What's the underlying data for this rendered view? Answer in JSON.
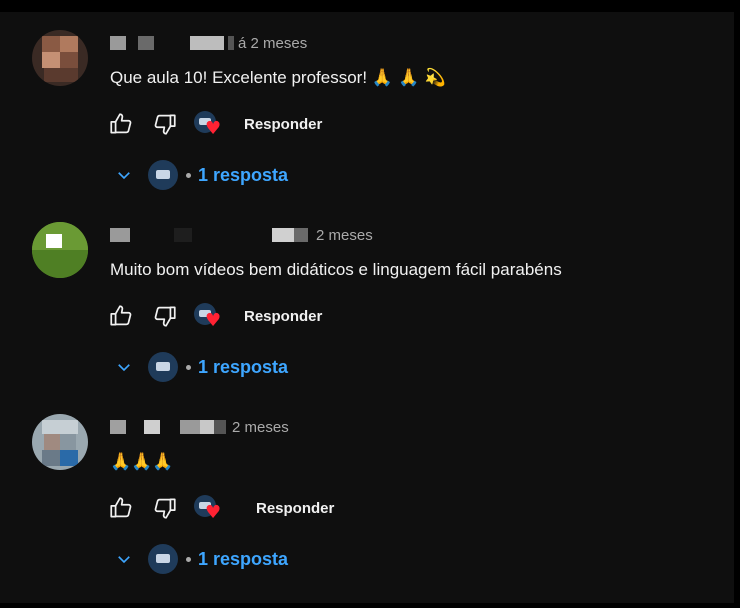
{
  "colors": {
    "background": "#0f0f0f",
    "text": "#f1f1f1",
    "muted": "#aaaaaa",
    "link": "#3ea6ff",
    "heart": "#ff2233"
  },
  "comments": [
    {
      "time": "á 2 meses",
      "text": "Que aula 10! Excelente professor!",
      "emojis": "🙏 🙏 💫",
      "like_icon": "thumbs-up-icon",
      "dislike_icon": "thumbs-down-icon",
      "heart_icon": "creator-heart-icon",
      "reply_label": "Responder",
      "replies_label": "1 resposta"
    },
    {
      "time": "2 meses",
      "text": "Muito bom vídeos bem didáticos e linguagem fácil parabéns",
      "emojis": "",
      "like_icon": "thumbs-up-icon",
      "dislike_icon": "thumbs-down-icon",
      "heart_icon": "creator-heart-icon",
      "reply_label": "Responder",
      "replies_label": "1 resposta"
    },
    {
      "time": "2 meses",
      "text": "",
      "emojis": "🙏🙏🙏",
      "like_icon": "thumbs-up-icon",
      "dislike_icon": "thumbs-down-icon",
      "heart_icon": "creator-heart-icon",
      "reply_label": "Responder",
      "replies_label": "1 resposta"
    }
  ]
}
